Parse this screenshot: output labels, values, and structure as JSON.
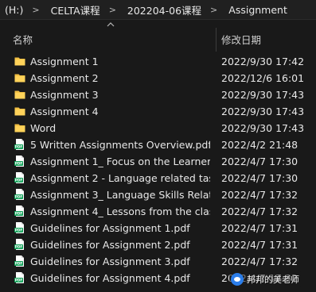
{
  "breadcrumb": [
    "(H:)",
    "CELTA课程",
    "202204-06课程",
    "Assignment"
  ],
  "columns": {
    "name": "名称",
    "date": "修改日期"
  },
  "files": [
    {
      "type": "folder",
      "name": "Assignment 1",
      "date": "2022/9/30 17:42"
    },
    {
      "type": "folder",
      "name": "Assignment 2",
      "date": "2022/12/6 16:01"
    },
    {
      "type": "folder",
      "name": "Assignment 3",
      "date": "2022/9/30 17:43"
    },
    {
      "type": "folder",
      "name": "Assignment 4",
      "date": "2022/9/30 17:43"
    },
    {
      "type": "folder",
      "name": "Word",
      "date": "2022/9/30 17:43"
    },
    {
      "type": "pdf",
      "name": "5 Written Assignments Overview.pdf",
      "date": "2022/4/2 21:48"
    },
    {
      "type": "pdf",
      "name": "Assignment 1_ Focus on the Learner.",
      "date": "2022/4/7 17:30"
    },
    {
      "type": "pdf",
      "name": "Assignment 2 - Language related tas",
      "date": "2022/4/7 17:30"
    },
    {
      "type": "pdf",
      "name": "Assignment 3_ Language Skills Relate",
      "date": "2022/4/7 17:32"
    },
    {
      "type": "pdf",
      "name": "Assignment 4_ Lessons from the clas",
      "date": "2022/4/7 17:32"
    },
    {
      "type": "pdf",
      "name": "Guidelines for Assignment 1.pdf",
      "date": "2022/4/7 17:31"
    },
    {
      "type": "pdf",
      "name": "Guidelines for Assignment 2.pdf",
      "date": "2022/4/7 17:31"
    },
    {
      "type": "pdf",
      "name": "Guidelines for Assignment 3.pdf",
      "date": "2022/4/7 17:32"
    },
    {
      "type": "pdf",
      "name": "Guidelines for Assignment 4.pdf",
      "date": "2022/4/7 17:32"
    }
  ],
  "watermark": {
    "text": "邦邦的美老师"
  },
  "colors": {
    "folder": "#f3c043",
    "pdf": "#14a35a",
    "background": "#191919"
  }
}
